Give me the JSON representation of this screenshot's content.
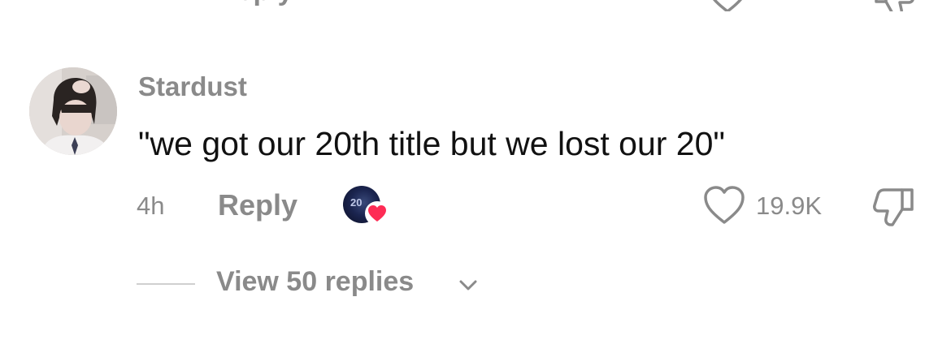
{
  "previous_comment": {
    "reply_label": "Reply"
  },
  "comment": {
    "username": "Stardust",
    "text": "\"we got our 20th title but we lost our 20\"",
    "timestamp": "4h",
    "reply_label": "Reply",
    "creator_liked": true,
    "creator_avatar_text": "20",
    "like_count": "19.9K",
    "view_replies_label": "View 50 replies"
  },
  "icons": {
    "like": "heart-outline-icon",
    "dislike": "thumbs-down-outline-icon",
    "creator_heart": "heart-filled-icon",
    "expand": "chevron-down-icon"
  },
  "colors": {
    "secondary_text": "#8a8a8a",
    "primary_text": "#111111",
    "heart_red": "#fe2c55",
    "divider": "#d0d0d0"
  }
}
